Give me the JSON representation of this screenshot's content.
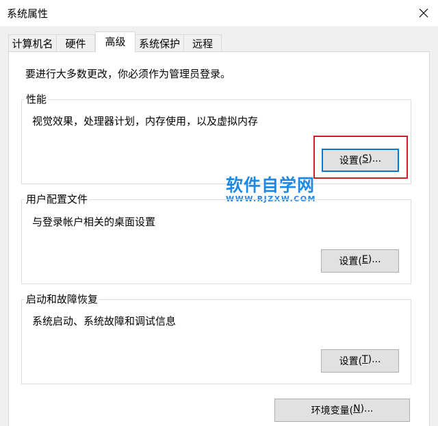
{
  "window": {
    "title": "系统属性"
  },
  "tabs": [
    {
      "label": "计算机名"
    },
    {
      "label": "硬件"
    },
    {
      "label": "高级"
    },
    {
      "label": "系统保护"
    },
    {
      "label": "远程"
    }
  ],
  "intro_text": "要进行大多数更改，你必须作为管理员登录。",
  "performance": {
    "title": "性能",
    "description": "视觉效果，处理器计划，内存使用，以及虚拟内存",
    "button": {
      "before": "设置(",
      "key": "S",
      "after": ")..."
    }
  },
  "user_profiles": {
    "title": "用户配置文件",
    "description": "与登录帐户相关的桌面设置",
    "button": {
      "before": "设置(",
      "key": "E",
      "after": ")..."
    }
  },
  "startup_recovery": {
    "title": "启动和故障恢复",
    "description": "系统启动、系统故障和调试信息",
    "button": {
      "before": "设置(",
      "key": "T",
      "after": ")..."
    }
  },
  "env_button": {
    "before": "环境变量(",
    "key": "N",
    "after": ")..."
  },
  "watermark": {
    "main": "软件自学网",
    "sub": "WWW.RJZXW.COM"
  },
  "colors": {
    "highlight": "#cc1f1f",
    "focus": "#0078d7",
    "watermark": "#1e88e5"
  }
}
